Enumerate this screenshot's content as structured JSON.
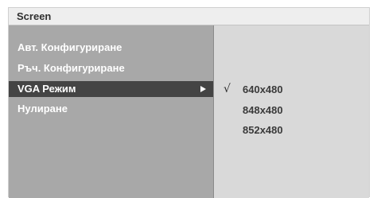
{
  "window": {
    "title": "Screen"
  },
  "menu": {
    "items": [
      {
        "label": "Авт. Конфигуриране"
      },
      {
        "label": "Ръч. Конфигуриране"
      },
      {
        "label": "VGA Режим"
      },
      {
        "label": "Нулиране"
      }
    ],
    "selected_index": 2
  },
  "submenu": {
    "options": [
      {
        "label": "640x480",
        "checked": true
      },
      {
        "label": "848x480",
        "checked": false
      },
      {
        "label": "852x480",
        "checked": false
      }
    ],
    "check_glyph": "√"
  },
  "icons": {
    "submenu_arrow": "arrow-right-icon",
    "check": "check-icon"
  }
}
